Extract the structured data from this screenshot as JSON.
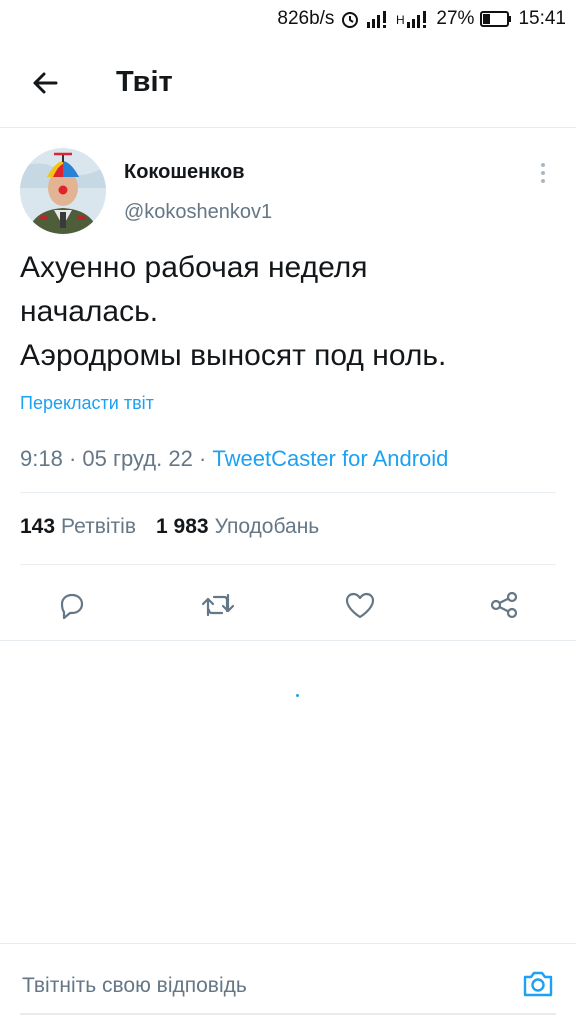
{
  "status_bar": {
    "net_speed": "826b/s",
    "battery": "27%",
    "time": "15:41",
    "icons": [
      "alarm-icon",
      "signal-icon",
      "signal-h-icon",
      "battery-icon"
    ]
  },
  "header": {
    "title": "Твіт",
    "back_icon": "arrow-left-icon"
  },
  "tweet": {
    "author_name": "Кокошенков",
    "author_handle": "@kokoshenkov1",
    "text_lines": [
      "Ахуенно рабочая неделя",
      "началась.",
      "Аэродромы выносят под ноль."
    ],
    "translate_label": "Перекласти твіт",
    "time": "9:18",
    "date": "05 груд. 22",
    "separator": "·",
    "source": "TweetCaster for Android",
    "retweets_count": "143",
    "retweets_label": "Ретвітів",
    "likes_count": "1 983",
    "likes_label": "Уподобань"
  },
  "actions": [
    "reply-icon",
    "retweet-icon",
    "like-icon",
    "share-icon"
  ],
  "reply_bar": {
    "placeholder": "Твітніть свою відповідь",
    "camera_icon": "camera-icon"
  },
  "colors": {
    "accent": "#1da1f2",
    "text": "#14171a",
    "secondary": "#657786",
    "divider": "#e6ecf0"
  }
}
